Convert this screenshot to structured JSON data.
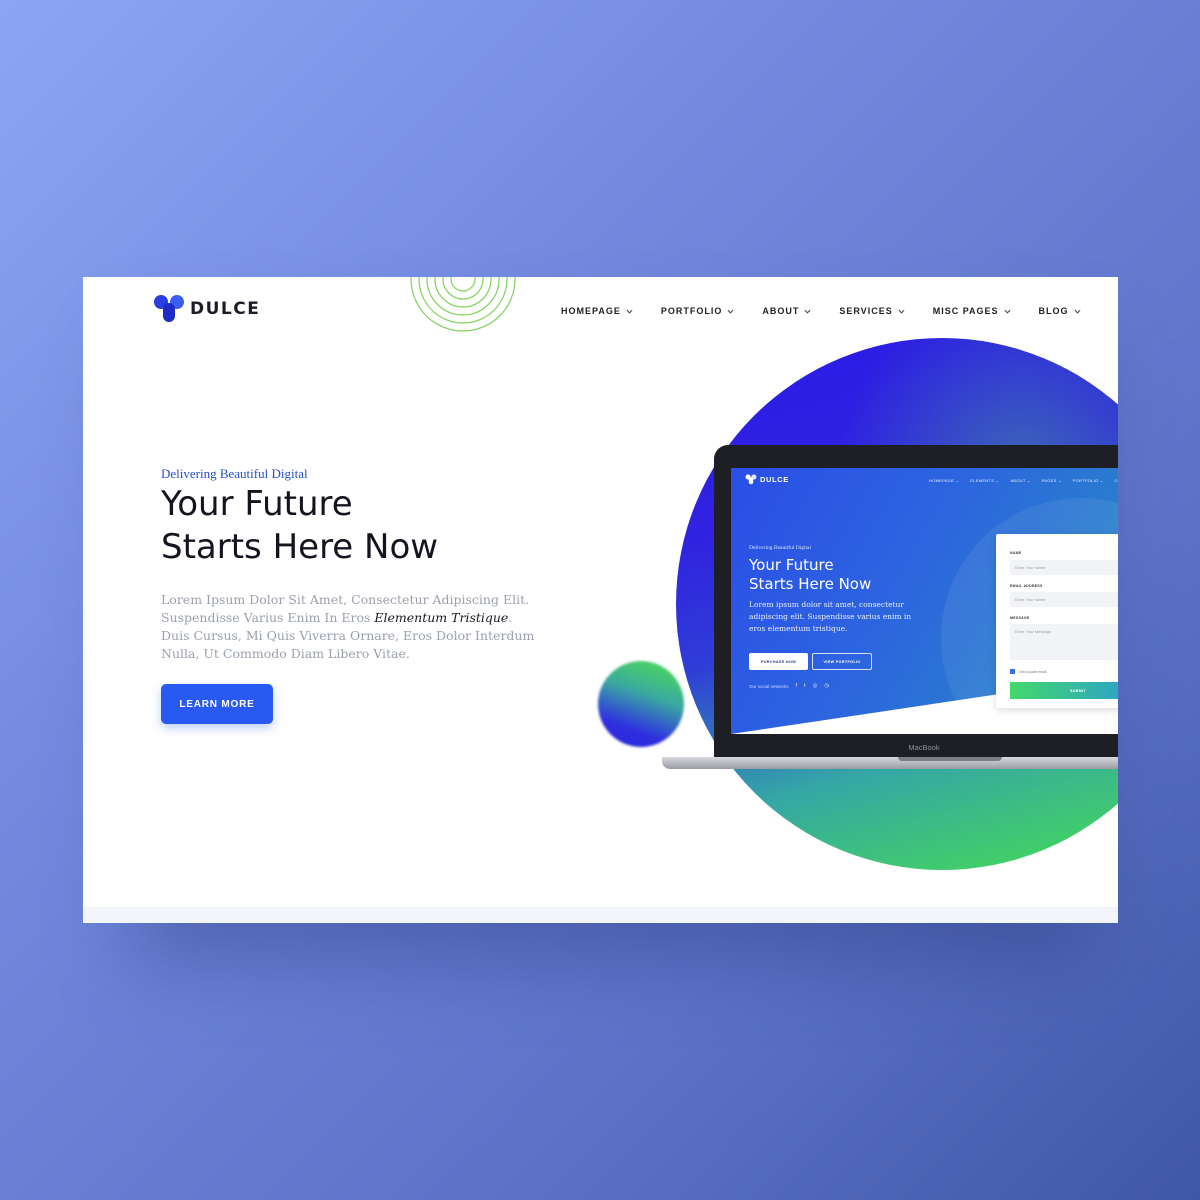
{
  "site": {
    "brand": "DULCE",
    "nav": [
      {
        "label": "HOMEPAGE"
      },
      {
        "label": "PORTFOLIO"
      },
      {
        "label": "ABOUT"
      },
      {
        "label": "SERVICES"
      },
      {
        "label": "MISC PAGES"
      },
      {
        "label": "BLOG"
      }
    ]
  },
  "hero": {
    "kicker": "Delivering Beautiful Digital",
    "headline_line1": "Your Future",
    "headline_line2": "Starts Here Now",
    "body_before": "Lorem Ipsum Dolor Sit Amet, Consectetur Adipiscing Elit. Suspendisse Varius Enim In Eros ",
    "body_emphasis": "Elementum Tristique",
    "body_after": ". Duis Cursus, Mi Quis Viverra Ornare, Eros Dolor Interdum Nulla, Ut Commodo Diam Libero Vitae.",
    "cta_label": "LEARN MORE"
  },
  "laptop": {
    "brand_label": "MacBook",
    "screen": {
      "brand": "DULCE",
      "nav": [
        "HOMEPAGE ⌄",
        "ELEMENTS ⌄",
        "ABOUT ⌄",
        "PAGES ⌄",
        "PORTFOLIO ⌄",
        "CO"
      ],
      "kicker": "Delivering Beautiful Digital",
      "headline_line1": "Your Future",
      "headline_line2": "Starts Here Now",
      "body": "Lorem ipsum dolor sit amet, consectetur adipiscing elit. Suspendisse varius enim in eros elementum tristique.",
      "primary_button": "PURCHASE NOW",
      "secondary_button": "VIEW PORTFOLIO",
      "social_label": "Our social networks",
      "social_icons": [
        "f",
        "t",
        "◎",
        "◷"
      ],
      "form": {
        "name_label": "NAME",
        "name_placeholder": "Enter Your Name",
        "email_label": "EMAIL ADDRESS",
        "email_placeholder": "Enter Your Name",
        "message_label": "MESSAGE",
        "message_placeholder": "Enter Your Message",
        "checkbox_label": "Get a quote email",
        "submit": "SUBMIT"
      }
    }
  },
  "colors": {
    "accent": "#2859f0",
    "kicker": "#2450c8",
    "gradient_blue": "#2a1be6",
    "gradient_green": "#48e14c"
  },
  "icons": [
    "logo-mark-icon",
    "chevron-down-icon",
    "concentric-rings-decoration"
  ]
}
